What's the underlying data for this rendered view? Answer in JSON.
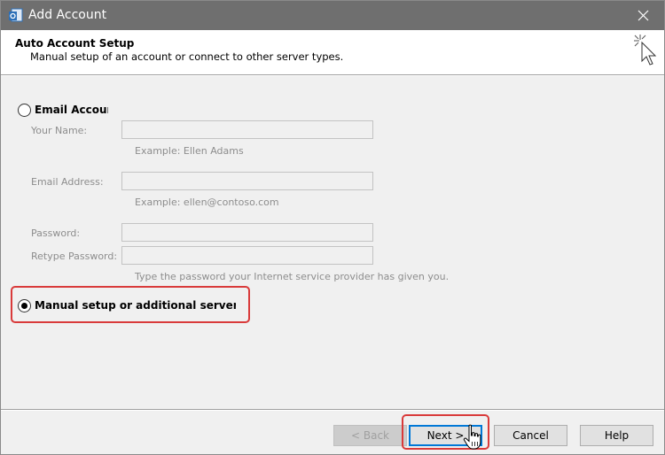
{
  "window": {
    "title": "Add Account"
  },
  "header": {
    "title": "Auto Account Setup",
    "subtitle": "Manual setup of an account or connect to other server types."
  },
  "email_account": {
    "label": "Email Account",
    "selected": false,
    "your_name": {
      "label": "Your Name:",
      "value": "",
      "hint": "Example: Ellen Adams"
    },
    "email_address": {
      "label": "Email Address:",
      "value": "",
      "hint": "Example: ellen@contoso.com"
    },
    "password": {
      "label": "Password:",
      "value": ""
    },
    "retype_password": {
      "label": "Retype Password:",
      "value": ""
    },
    "password_hint": "Type the password your Internet service provider has given you."
  },
  "manual_setup": {
    "label": "Manual setup or additional server types",
    "selected": true
  },
  "buttons": {
    "back": "< Back",
    "next": "Next >",
    "cancel": "Cancel",
    "help": "Help"
  },
  "colors": {
    "titlebar": "#6f6f6f",
    "highlight": "#d93a3a",
    "focus": "#0078d7"
  }
}
